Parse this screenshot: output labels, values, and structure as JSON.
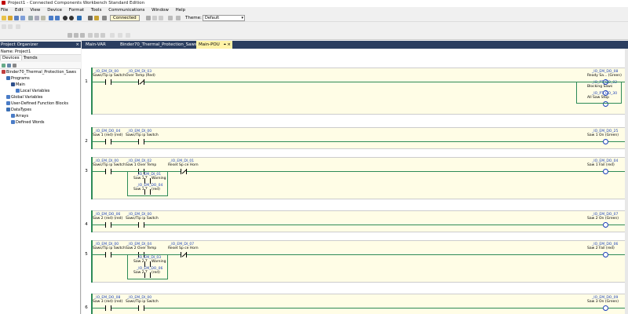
{
  "window": {
    "title": "Project1 - Connected Components Workbench Standard Edition"
  },
  "menu": [
    "File",
    "Edit",
    "View",
    "Device",
    "Format",
    "Tools",
    "Communications",
    "Window",
    "Help"
  ],
  "toolbar": {
    "connected_label": "Connected",
    "theme_label": "Theme:",
    "theme_value": "Default"
  },
  "organizer": {
    "title": "Project Organizer",
    "close": "×",
    "name_label": "Name:",
    "name_value": "Project1",
    "tabs": [
      "Devices",
      "Trends"
    ],
    "tree": [
      {
        "label": "Binder70_Thermal_Protection_Saws",
        "level": 0,
        "icon": "controller-icon"
      },
      {
        "label": "Programs",
        "level": 1,
        "icon": "programs-folder-icon"
      },
      {
        "label": "Main",
        "level": 2,
        "icon": "program-icon"
      },
      {
        "label": "Local Variables",
        "level": 3,
        "icon": "variables-icon"
      },
      {
        "label": "Global Variables",
        "level": 1,
        "icon": "variables-icon"
      },
      {
        "label": "User-Defined Function Blocks",
        "level": 1,
        "icon": "function-block-icon"
      },
      {
        "label": "DataTypes",
        "level": 1,
        "icon": "datatypes-folder-icon"
      },
      {
        "label": "Arrays",
        "level": 2,
        "icon": "array-icon"
      },
      {
        "label": "Defined Words",
        "level": 2,
        "icon": "defined-words-icon"
      }
    ]
  },
  "doc_tabs": [
    {
      "label": "Main-VAR",
      "active": false
    },
    {
      "label": "Binder70_Thermal_Protection_Saws",
      "active": false
    },
    {
      "label": "Main-POU",
      "active": true,
      "pin": "⌖",
      "close": "×"
    }
  ],
  "rungs": [
    {
      "number": "1",
      "contacts": [
        {
          "tag": "_IO_EM_DI_00",
          "desc": "Saws/Tip ip Switch",
          "nc": false
        },
        {
          "tag": "_IO_EM_DI_03",
          "desc": "Over Temp (Red)",
          "nc": true
        }
      ],
      "coils": [
        {
          "tag": "_IO_EM_DO_08",
          "desc": "Ready Sa... (Green)"
        },
        {
          "tag": "_IO_PT_DO_02",
          "desc": "Blocking Saws"
        },
        {
          "tag": "_IO_PT_DO_30",
          "desc": "All Saw Stop"
        }
      ]
    },
    {
      "number": "2",
      "contacts": [
        {
          "tag": "_IO_EM_DO_04",
          "desc": "Saw 1 (red) (red)",
          "nc": false
        },
        {
          "tag": "_IO_EM_DI_00",
          "desc": "Saws/Tip ip Switch",
          "nc": false
        }
      ],
      "coils": [
        {
          "tag": "_IO_EM_DO_25",
          "desc": "Saw 1 On (Green)"
        }
      ]
    },
    {
      "number": "3",
      "contacts": [
        {
          "tag": "_IO_EM_DI_00",
          "desc": "Saws/Tip ip Switch",
          "nc": false
        },
        {
          "tag": "_IO_EM_DI_02",
          "desc": "Saw 1 Over Temp",
          "nc": false
        },
        {
          "tag": "_IO_EM_DI_01",
          "desc": "Reset Sp ce Horn",
          "nc": true
        }
      ],
      "branch": [
        {
          "tag": "_IO_EM_DI_01",
          "desc": "Saw 1 T... Warning"
        },
        {
          "tag": "_IO_EM_DO_04",
          "desc": "Saw 1 T... (red)"
        }
      ],
      "coils": [
        {
          "tag": "_IO_EM_DO_04",
          "desc": "Saw 1 Fail (red)"
        }
      ]
    },
    {
      "number": "4",
      "contacts": [
        {
          "tag": "_IO_EM_DO_06",
          "desc": "Saw 2 (red) (red)",
          "nc": false
        },
        {
          "tag": "_IO_EM_DI_00",
          "desc": "Saws/Tip ip Switch",
          "nc": false
        }
      ],
      "coils": [
        {
          "tag": "_IO_EM_DO_07",
          "desc": "Saw 2 On (Green)"
        }
      ]
    },
    {
      "number": "5",
      "contacts": [
        {
          "tag": "_IO_EM_DI_00",
          "desc": "Saws/Tip ip Switch",
          "nc": false
        },
        {
          "tag": "_IO_EM_DI_04",
          "desc": "Saw 2 Over Temp",
          "nc": false
        },
        {
          "tag": "_IO_EM_DI_07",
          "desc": "Reset Sp ce Horn",
          "nc": true
        }
      ],
      "branch": [
        {
          "tag": "_IO_EM_DI_03",
          "desc": "Saw 2 T... Warning"
        },
        {
          "tag": "_IO_EM_DO_06",
          "desc": "Saw 2 T... (red)"
        }
      ],
      "coils": [
        {
          "tag": "_IO_EM_DO_06",
          "desc": "Saw 2 Fail (red)"
        }
      ]
    },
    {
      "number": "6",
      "contacts": [
        {
          "tag": "_IO_EM_DO_08",
          "desc": "Saw 3 (red) (red)",
          "nc": false
        },
        {
          "tag": "_IO_EM_DI_00",
          "desc": "Saws/Tip ip Switch",
          "nc": false
        }
      ],
      "coils": [
        {
          "tag": "_IO_EM_DO_09",
          "desc": "Saw 3 On (Green)"
        }
      ]
    }
  ]
}
